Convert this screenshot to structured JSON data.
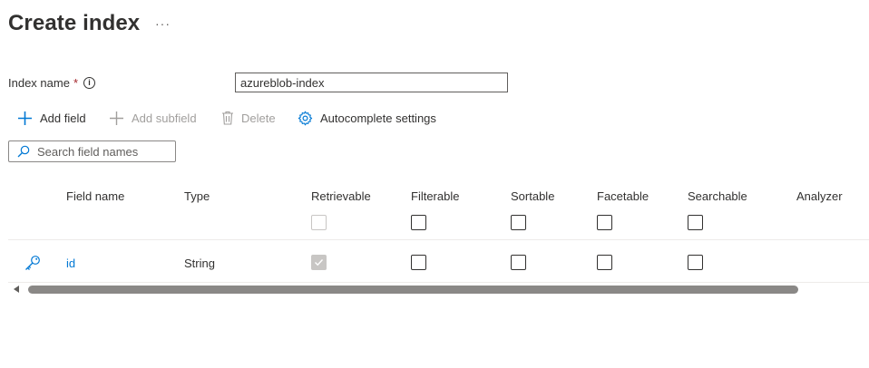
{
  "header": {
    "title": "Create index",
    "more_label": "···"
  },
  "index_name": {
    "label": "Index name",
    "required_mark": "*",
    "info_glyph": "i",
    "value": "azureblob-index"
  },
  "toolbar": {
    "add_field": "Add field",
    "add_subfield": "Add subfield",
    "delete": "Delete",
    "autocomplete": "Autocomplete settings"
  },
  "search": {
    "placeholder": "Search field names",
    "value": ""
  },
  "table": {
    "columns": [
      "Field name",
      "Type",
      "Retrievable",
      "Filterable",
      "Sortable",
      "Facetable",
      "Searchable",
      "Analyzer"
    ],
    "header_checkboxes": {
      "retrievable": "unchecked-disabled",
      "filterable": false,
      "sortable": false,
      "facetable": false,
      "searchable": false
    },
    "rows": [
      {
        "icon": "key-icon",
        "name": "id",
        "type": "String",
        "retrievable": "checked-disabled",
        "filterable": false,
        "sortable": false,
        "facetable": false,
        "searchable": false,
        "analyzer": ""
      }
    ]
  },
  "colors": {
    "accent": "#0078d4",
    "text": "#323130",
    "disabled": "#a19f9d",
    "required": "#a4262c"
  }
}
